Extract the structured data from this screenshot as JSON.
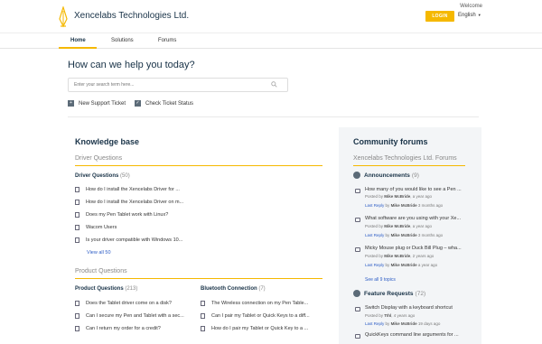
{
  "header": {
    "brand": "Xencelabs Technologies Ltd.",
    "welcome": "Welcome",
    "login_label": "LOGIN",
    "language": "English"
  },
  "nav": {
    "items": [
      {
        "label": "Home"
      },
      {
        "label": "Solutions"
      },
      {
        "label": "Forums"
      }
    ]
  },
  "hero": {
    "title": "How can we help you today?",
    "search_placeholder": "Enter your search term here...",
    "new_ticket": "New Support Ticket",
    "check_status": "Check Ticket Status"
  },
  "knowledge_base": {
    "title": "Knowledge base",
    "driver_section": "Driver Questions",
    "driver_cat": {
      "title": "Driver Questions",
      "count": "(50)"
    },
    "driver_articles": [
      "How do I install the Xencelabs Driver for ...",
      "How do I install the Xencelabs Driver on m...",
      "Does my Pen Tablet work with Linux?",
      "Wacom Users",
      "Is your driver compatible with Windows 10..."
    ],
    "view_all": "View all 50",
    "product_section": "Product Questions",
    "product_cat": {
      "title": "Product Questions",
      "count": "(213)"
    },
    "product_articles": [
      "Does the Tablet driver come on a disk?",
      "Can I secure my Pen and Tablet with a sec...",
      "Can I return my order for a credit?"
    ],
    "bt_cat": {
      "title": "Bluetooth Connection",
      "count": "(7)"
    },
    "bt_articles": [
      "The Wireless connection on my Pen Table...",
      "Can I pair my Tablet or Quick Keys to a diff...",
      "How do I pair my Tablet or Quick Key to a ..."
    ]
  },
  "community": {
    "title": "Community forums",
    "subtitle": "Xencelabs Technologies Ltd. Forums",
    "announcements": {
      "title": "Announcements",
      "count": "(9)"
    },
    "topics": [
      {
        "title": "How many of you would like to see a Pen ...",
        "posted_prefix": "Posted by",
        "author": "Mike McBride",
        "posted_time": ", a year ago",
        "reply_label": "Last Reply",
        "reply_by": "by",
        "reply_author": "Mike McBride",
        "reply_time": "3 months ago"
      },
      {
        "title": "What software are you using with your Xe...",
        "posted_prefix": "Posted by",
        "author": "Mike McBride",
        "posted_time": ", a year ago",
        "reply_label": "Last Reply",
        "reply_by": "by",
        "reply_author": "Mike McBride",
        "reply_time": "3 months ago"
      },
      {
        "title": "Micky Mouse plug or Duck Bill Plug – wha...",
        "posted_prefix": "Posted by",
        "author": "Mike McBride",
        "posted_time": ", 2 years ago",
        "reply_label": "Last Reply",
        "reply_by": "by",
        "reply_author": "Mike McBride",
        "reply_time": "a year ago"
      }
    ],
    "see_all": "See all 9 topics",
    "feature": {
      "title": "Feature Requests",
      "count": "(72)"
    },
    "feature_topics": [
      {
        "title": "Switch Display with a keyboard shortcut",
        "posted_prefix": "Posted by",
        "author": "TIhl",
        "posted_time": ", 4 years ago",
        "reply_label": "Last Reply",
        "reply_by": "by",
        "reply_author": "Mike McBride",
        "reply_time": "19 days ago"
      },
      {
        "title": "QuickKeys command line arguments for ..."
      }
    ]
  },
  "colors": {
    "accent": "#f5b800",
    "brand": "#183247",
    "link": "#2c5cc5"
  }
}
